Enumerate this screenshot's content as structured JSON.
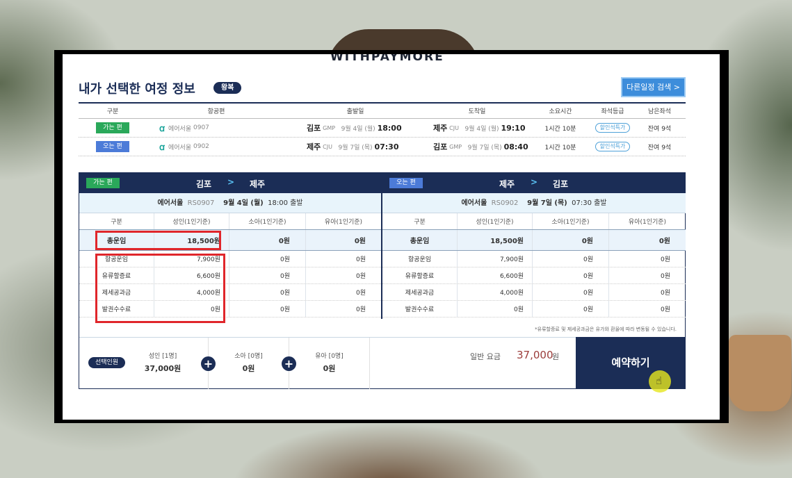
{
  "logo": "WITHPAYMORE",
  "page_title": "내가 선택한 여정 정보",
  "trip_type": "왕복",
  "other_search": "다른일정 검색 >",
  "summary": {
    "headers": [
      "구분",
      "항공편",
      "출발일",
      "도착일",
      "소요시간",
      "좌석등급",
      "남은좌석"
    ],
    "rows": [
      {
        "type": "가는 편",
        "airline": "에어서울",
        "flight": "0907",
        "dep_city": "김포",
        "dep_code": "GMP",
        "dep_date": "9월 4일 (월)",
        "dep_time": "18:00",
        "arr_city": "제주",
        "arr_code": "CJU",
        "arr_date": "9월 4일 (월)",
        "arr_time": "19:10",
        "duration": "1시간 10분",
        "seat": "할인석특가",
        "remain": "잔여 9석"
      },
      {
        "type": "오는 편",
        "airline": "에어서울",
        "flight": "0902",
        "dep_city": "제주",
        "dep_code": "CJU",
        "dep_date": "9월 7일 (목)",
        "dep_time": "07:30",
        "arr_city": "김포",
        "arr_code": "GMP",
        "arr_date": "9월 7일 (목)",
        "arr_time": "08:40",
        "duration": "1시간 10분",
        "seat": "할인석특가",
        "remain": "잔여 9석"
      }
    ]
  },
  "outbound": {
    "label": "가는 편",
    "from": "김포",
    "to": "제주",
    "airline": "에어서울",
    "flight": "RS0907",
    "date": "9월 4일 (월)",
    "time": "18:00 출발",
    "headers": [
      "구분",
      "성인(1인기준)",
      "소아(1인기준)",
      "유아(1인기준)"
    ],
    "total": {
      "label": "총운임",
      "adult": "18,500원",
      "child": "0원",
      "infant": "0원"
    },
    "rows": [
      {
        "label": "항공운임",
        "adult": "7,900원",
        "child": "0원",
        "infant": "0원"
      },
      {
        "label": "유류할증료",
        "adult": "6,600원",
        "child": "0원",
        "infant": "0원"
      },
      {
        "label": "제세공과금",
        "adult": "4,000원",
        "child": "0원",
        "infant": "0원"
      },
      {
        "label": "발권수수료",
        "adult": "0원",
        "child": "0원",
        "infant": "0원"
      }
    ]
  },
  "inbound": {
    "label": "오는 편",
    "from": "제주",
    "to": "김포",
    "airline": "에어서울",
    "flight": "RS0902",
    "date": "9월 7일 (목)",
    "time": "07:30 출발",
    "headers": [
      "구분",
      "성인(1인기준)",
      "소아(1인기준)",
      "유아(1인기준)"
    ],
    "total": {
      "label": "총운임",
      "adult": "18,500원",
      "child": "0원",
      "infant": "0원"
    },
    "rows": [
      {
        "label": "항공운임",
        "adult": "7,900원",
        "child": "0원",
        "infant": "0원"
      },
      {
        "label": "유류할증료",
        "adult": "6,600원",
        "child": "0원",
        "infant": "0원"
      },
      {
        "label": "제세공과금",
        "adult": "4,000원",
        "child": "0원",
        "infant": "0원"
      },
      {
        "label": "발권수수료",
        "adult": "0원",
        "child": "0원",
        "infant": "0원"
      }
    ]
  },
  "note": "*유류할증료 및 제세공과금은 유가와 환율에 따라 변동될 수 있습니다.",
  "selection": {
    "badge": "선택인원",
    "adult_label": "성인 [1명]",
    "adult_price": "37,000원",
    "child_label": "소아 [0명]",
    "child_price": "0원",
    "infant_label": "유아 [0명]",
    "infant_price": "0원",
    "plus": "+"
  },
  "fare": {
    "label": "일반 요금",
    "value": "37,000",
    "unit": "원"
  },
  "book": "예약하기",
  "arrow": ">"
}
